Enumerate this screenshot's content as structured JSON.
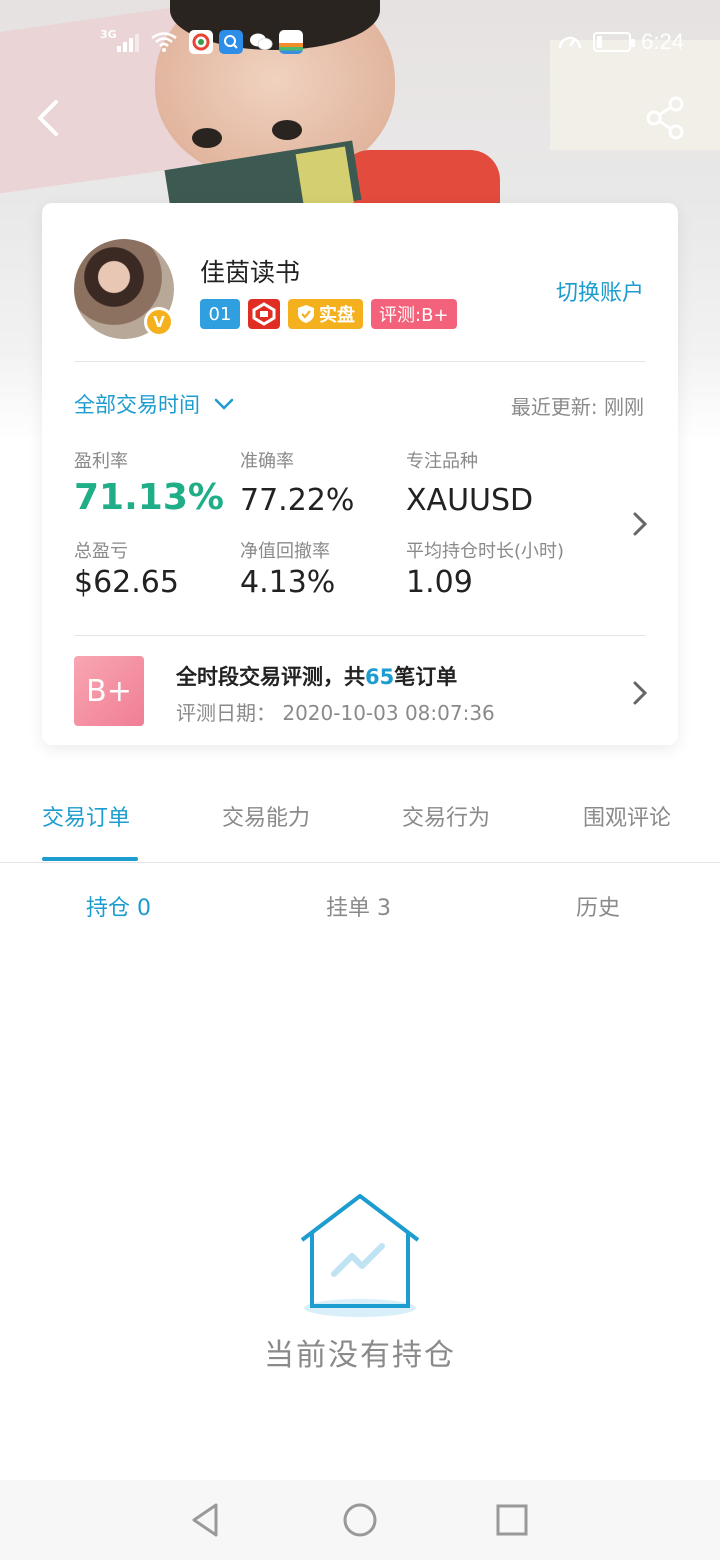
{
  "status_bar": {
    "network": "3G",
    "time": "6:24",
    "app_icons": [
      "baidu-map-icon",
      "browser-icon",
      "wechat-icon",
      "life-app-icon"
    ],
    "battery_level": 0.15
  },
  "profile": {
    "name": "佳茵读书",
    "switch_account": "切换账户",
    "badges": {
      "rank": "01",
      "live": "实盘",
      "eval": "评测:B+"
    }
  },
  "filter": {
    "period": "全部交易时间",
    "updated": "最近更新: 刚刚"
  },
  "stats": {
    "profit_rate_label": "盈利率",
    "profit_rate_value": "71.13%",
    "accuracy_label": "准确率",
    "accuracy_value": "77.22%",
    "focus_label": "专注品种",
    "focus_value": "XAUUSD",
    "total_pl_label": "总盈亏",
    "total_pl_value": "$62.65",
    "drawdown_label": "净值回撤率",
    "drawdown_value": "4.13%",
    "hold_label": "平均持仓时长(小时)",
    "hold_value": "1.09"
  },
  "evaluation": {
    "grade": "B+",
    "title_prefix": "全时段交易评测，共",
    "title_count": "65",
    "title_suffix": "笔订单",
    "date": "评测日期：  2020-10-03 08:07:36"
  },
  "tabs": [
    "交易订单",
    "交易能力",
    "交易行为",
    "围观评论"
  ],
  "subtabs": [
    "持仓 0",
    "挂单 3",
    "历史"
  ],
  "empty_state": {
    "message": "当前没有持仓"
  },
  "colors": {
    "accent": "#1c9ccf",
    "profit": "#1fae87",
    "gold": "#f4b01d",
    "eval_pink": "#f4617a"
  }
}
